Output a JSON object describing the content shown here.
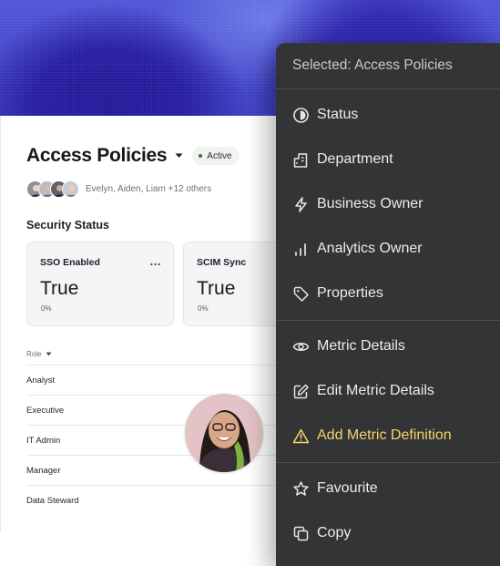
{
  "page": {
    "title": "Access Policies",
    "status_badge": "Active",
    "members_text": "Evelyn, Aiden, Liam +12 others",
    "section_title": "Security Status"
  },
  "stats": [
    {
      "label": "SSO Enabled",
      "value": "True",
      "sub": "0%",
      "more": "..."
    },
    {
      "label": "SCIM Sync",
      "value": "True",
      "sub": "0%"
    }
  ],
  "table": {
    "column_header": "Role",
    "rows": [
      "Analyst",
      "Executive",
      "IT Admin",
      "Manager",
      "Data Steward"
    ]
  },
  "menu": {
    "header": "Selected: Access Policies",
    "groups": [
      [
        {
          "label": "Status",
          "icon": "status-icon"
        },
        {
          "label": "Department",
          "icon": "building-icon"
        },
        {
          "label": "Business Owner",
          "icon": "lightning-icon"
        },
        {
          "label": "Analytics Owner",
          "icon": "bar-chart-icon"
        },
        {
          "label": "Properties",
          "icon": "tag-icon"
        }
      ],
      [
        {
          "label": "Metric Details",
          "icon": "eye-icon"
        },
        {
          "label": "Edit Metric Details",
          "icon": "edit-icon"
        },
        {
          "label": "Add Metric Definition",
          "icon": "warning-icon",
          "color": "#f7d46f"
        }
      ],
      [
        {
          "label": "Favourite",
          "icon": "star-icon"
        },
        {
          "label": "Copy",
          "icon": "copy-icon"
        }
      ]
    ]
  },
  "colors": {
    "hero": "#3d3fc4",
    "menu_bg": "#333436",
    "warning": "#f7d46f",
    "badge_dot": "#3d6f3e"
  }
}
